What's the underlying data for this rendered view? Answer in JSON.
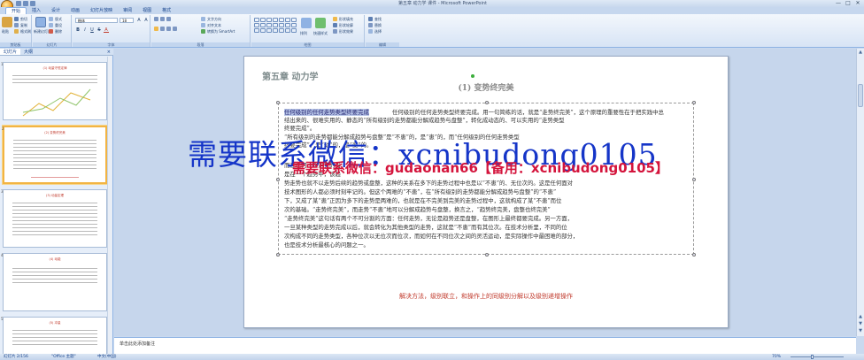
{
  "window": {
    "title": "第五章 动力学 课件 - Microsoft PowerPoint",
    "controls": [
      "—",
      "□",
      "✕"
    ]
  },
  "ribbon": {
    "tabs": [
      "开始",
      "插入",
      "设计",
      "动画",
      "幻灯片放映",
      "审阅",
      "视图",
      "格式"
    ],
    "active_tab": "开始",
    "groups": [
      {
        "label": "剪贴板",
        "items": [
          "粘贴",
          "剪切",
          "复制",
          "格式刷"
        ]
      },
      {
        "label": "幻灯片",
        "items": [
          "新建幻灯片",
          "版式",
          "重设",
          "删除"
        ]
      },
      {
        "label": "字体",
        "font_name": "楷体",
        "font_size": "18",
        "buttons": [
          "B",
          "I",
          "U",
          "S",
          "A"
        ]
      },
      {
        "label": "段落",
        "items": [
          "文字方向",
          "对齐文本",
          "转换为 SmartArt"
        ]
      },
      {
        "label": "绘图",
        "items": [
          "排列",
          "快速样式",
          "形状填充",
          "形状轮廓",
          "形状效果"
        ]
      },
      {
        "label": "编辑",
        "items": [
          "查找",
          "替换",
          "选择"
        ]
      }
    ]
  },
  "left_pane": {
    "tabs": [
      "幻灯片",
      "大纲"
    ],
    "close": "×",
    "thumbnails": [
      {
        "number": "1",
        "title": "(1) 动量守恒定律"
      },
      {
        "number": "2",
        "title": "(2) 变势终完美"
      },
      {
        "number": "3",
        "title": "(3) 动量定理"
      },
      {
        "number": "4",
        "title": "(4) 动能"
      },
      {
        "number": "5",
        "title": "(5) 冲量"
      }
    ]
  },
  "slide": {
    "heading": "第五章 动力学",
    "subtitle": "(1) 变势终完美",
    "body_lines": [
      "任何级别的任何走势类型终要完成。用一句简练的话，就是“走势终完美”，这个原理的重要性在于把实践中总",
      "结出来的、很难实用的、静态的“所有级别的走势都能分解成趋势与盘整”，转化成动态的、可以实用的“走势类型",
      "终要完成”。",
      "“所有级别的走势都能分解成趋势与盘整”是“不患”的，是“患”的，而“任何级别的任何走势类型",
      "终要完成”，是“动”的，是“变”的。",
      "",
      "                                                                                而在任何一个走势的当",
      "                                                                                是在一个趋势中，该趋",
      "势走势也就不以走势后续的趋势或盘整，这种的关系在多下的走势过程中也是以“不患”的、无位次的。这是任何面对",
      "技术图形的人都必须时刻牢记的。但这个两难的“不患”，在“所有级别的走势都能分解成趋势与盘整”的“不患”",
      "下，又成了某“患”正因为多下的走势是两难的，也就是在不完美到完美的走势过程中，这就构成了某“不患”而位",
      "次的基础。“走势终完美”，而走势“不患”地可以分解成趋势与盘整，换言之，“趋势终完美，盘整也终完美”",
      "“走势终完美”这句话有两个不可分割的方面：任何走势，无论是趋势还是盘整，在图形上最终都要完成。另一方面，",
      "一旦某种类型的走势完成以后，就会转化为其他类型的走势，这就是“不患”而有其位次。在技术分析里，不同的位",
      "次构成不同的走势类型，各种位次以无位次而位次，而如何在不同位次之间的灵活运动，是实际操作中最困难的部分，",
      "也是技术分析最核心的问题之一。"
    ],
    "highlighted_text": "任何级别的任何走势类型终要完成",
    "footer": "解决方法，级别联立，和操作上的同级别分解以及级别递增操作"
  },
  "watermarks": {
    "large": "需要联系微信：xcnibudong0105",
    "small": "需要联系微信：gudaonan66【备用：xcnibudong0105】"
  },
  "notes": {
    "placeholder": "单击此处添加备注"
  },
  "status_bar": {
    "slide_info": "幻灯片 2/156",
    "theme": "\"Office 主题\"",
    "language": "中文(中国)",
    "zoom": "70%"
  },
  "colors": {
    "accent": "#15428b",
    "watermark_blue": "#1535c8",
    "watermark_red": "#d4143c",
    "footer_red": "#c0392b"
  }
}
